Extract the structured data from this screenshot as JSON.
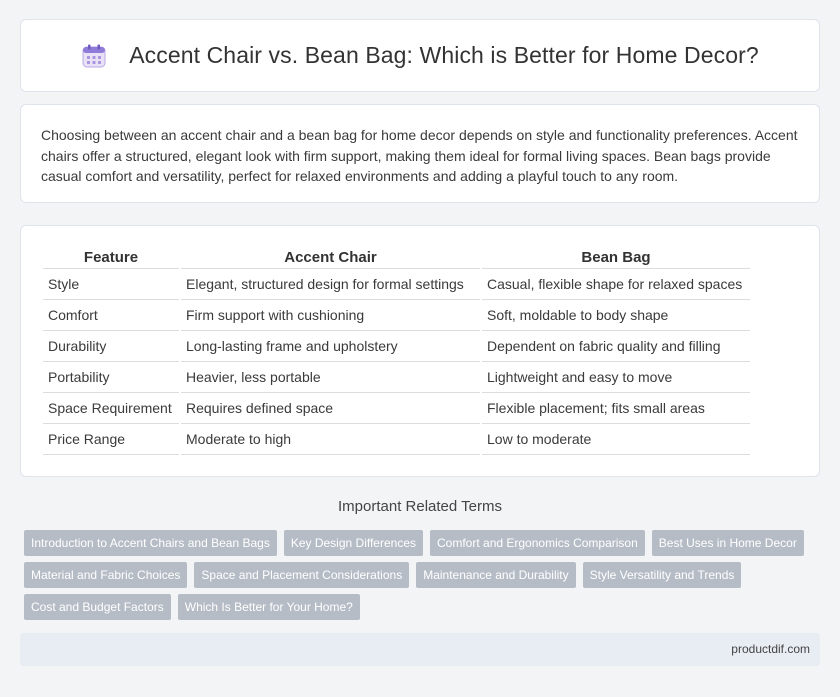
{
  "header": {
    "title": "Accent Chair vs. Bean Bag: Which is Better for Home Decor?",
    "icon": "calendar-icon"
  },
  "intro": {
    "text": "Choosing between an accent chair and a bean bag for home decor depends on style and functionality preferences. Accent chairs offer a structured, elegant look with firm support, making them ideal for formal living spaces. Bean bags provide casual comfort and versatility, perfect for relaxed environments and adding a playful touch to any room."
  },
  "table": {
    "headers": [
      "Feature",
      "Accent Chair",
      "Bean Bag"
    ],
    "rows": [
      [
        "Style",
        "Elegant, structured design for formal settings",
        "Casual, flexible shape for relaxed spaces"
      ],
      [
        "Comfort",
        "Firm support with cushioning",
        "Soft, moldable to body shape"
      ],
      [
        "Durability",
        "Long-lasting frame and upholstery",
        "Dependent on fabric quality and filling"
      ],
      [
        "Portability",
        "Heavier, less portable",
        "Lightweight and easy to move"
      ],
      [
        "Space Requirement",
        "Requires defined space",
        "Flexible placement; fits small areas"
      ],
      [
        "Price Range",
        "Moderate to high",
        "Low to moderate"
      ]
    ]
  },
  "related": {
    "title": "Important Related Terms",
    "rows": [
      [
        "Introduction to Accent Chairs and Bean Bags",
        "Key Design Differences",
        "Comfort and Ergonomics Comparison",
        "Best Uses in Home Decor"
      ],
      [
        "Material and Fabric Choices",
        "Space and Placement Considerations",
        "Maintenance and Durability",
        "Style Versatility and Trends"
      ],
      [
        "Cost and Budget Factors",
        "Which Is Better for Your Home?"
      ]
    ]
  },
  "footer": {
    "site": "productdif.com"
  },
  "colors": {
    "tag_bg": "#b6bcc6",
    "footer_bg": "#e8ecf3",
    "page_bg": "#f3f4f6"
  }
}
